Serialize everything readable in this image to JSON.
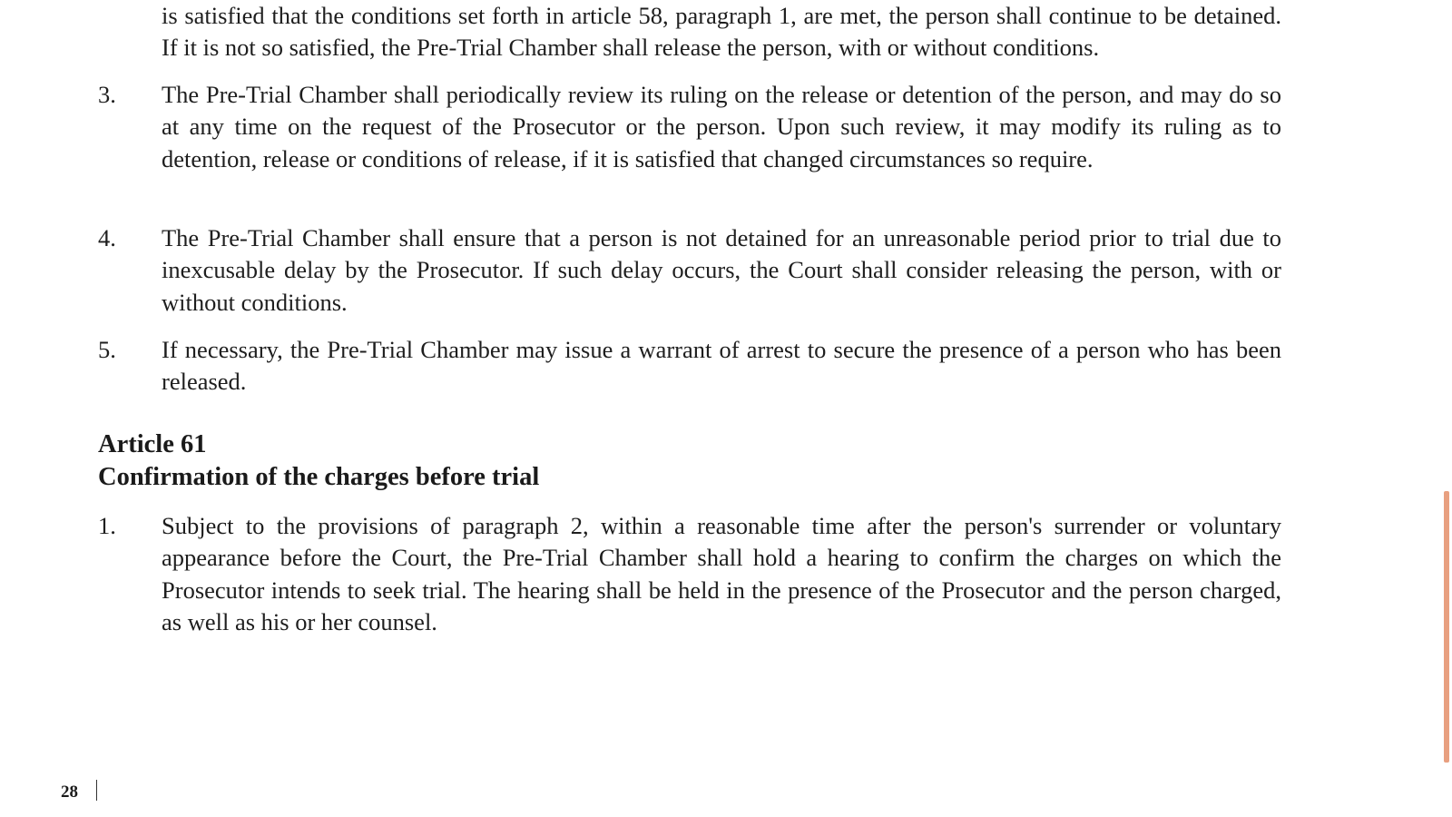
{
  "document": {
    "paragraphs_before": [
      {
        "number": "",
        "text": "is satisfied that the conditions set forth in article 58, paragraph 1, are met, the person shall continue to be detained. If it is not so satisfied, the Pre-Trial Chamber shall release the person, with or without conditions."
      },
      {
        "number": "3.",
        "text": "The Pre-Trial Chamber shall periodically review its ruling on the release or detention of the person, and may do so at any time on the request of the Prosecutor or the person. Upon such review, it may modify its ruling as to detention, release or conditions of release, if it is satisfied that changed circumstances so require."
      },
      {
        "number": "4.",
        "text": "The Pre-Trial Chamber shall ensure that a person is not detained for an unreasonable period prior to trial due to inexcusable delay by the Prosecutor. If such delay occurs, the Court shall consider releasing the person, with or without conditions."
      },
      {
        "number": "5.",
        "text": "If necessary, the Pre-Trial Chamber may issue a warrant of arrest to secure the presence of a person who has been released."
      }
    ],
    "article": {
      "number_label": "Article 61",
      "title": "Confirmation of the charges before trial"
    },
    "paragraphs_after": [
      {
        "number": "1.",
        "text": "Subject to the provisions of paragraph 2, within a reasonable time after the person's surrender or voluntary appearance before the Court, the Pre-Trial Chamber shall hold a hearing to confirm the charges on which the Prosecutor intends to seek trial. The hearing shall be held in the presence of the Prosecutor and the person charged, as well as his or her counsel."
      }
    ],
    "page_number": "28"
  },
  "colors": {
    "text": "#1e1e1e",
    "accent_bar": "#e8a080"
  }
}
